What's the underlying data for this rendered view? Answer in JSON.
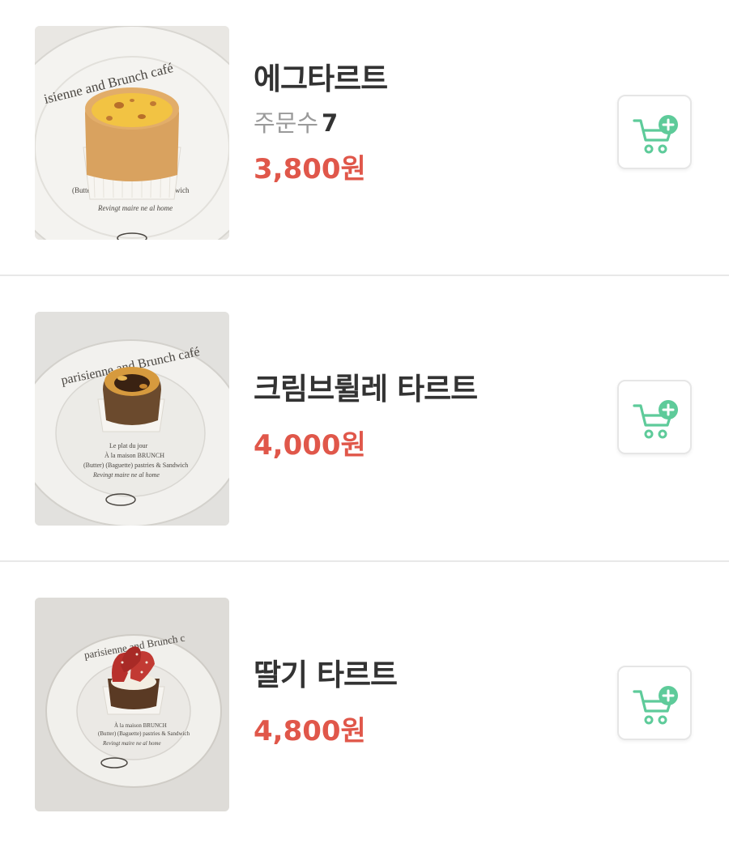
{
  "items": [
    {
      "name": "에그타르트",
      "orders_label": "주문수",
      "orders_count": "7",
      "price": "3,800원",
      "photo": "egg-tart-photo",
      "cart_icon": "add-to-cart-icon"
    },
    {
      "name": "크림브륄레 타르트",
      "price": "4,000원",
      "photo": "creme-brulee-tart-photo",
      "cart_icon": "add-to-cart-icon"
    },
    {
      "name": "딸기 타르트",
      "price": "4,800원",
      "photo": "strawberry-tart-photo",
      "cart_icon": "add-to-cart-icon"
    }
  ],
  "colors": {
    "price": "#e0574a",
    "cart_accent": "#5ecb9a",
    "divider": "#e8e8e8",
    "name": "#333333"
  }
}
